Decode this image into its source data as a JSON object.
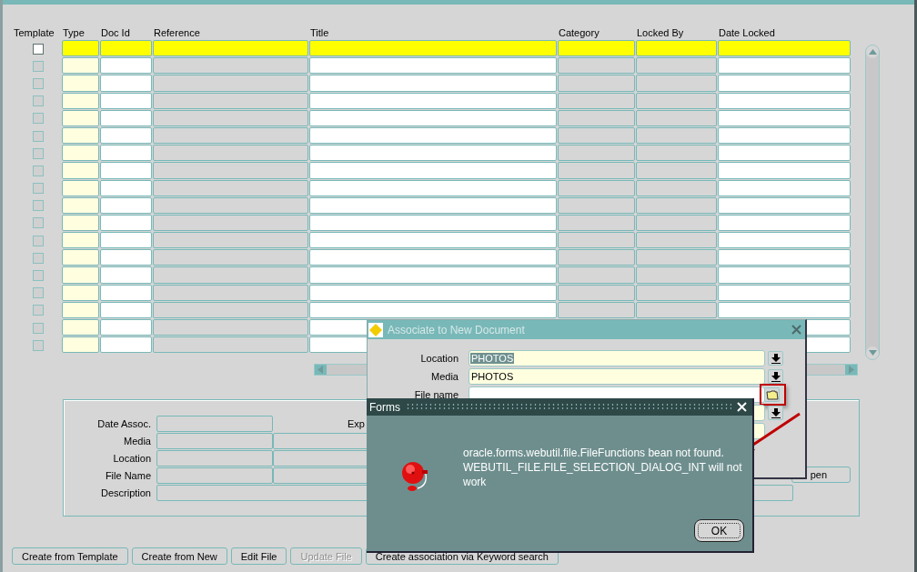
{
  "grid": {
    "columns": [
      "Template",
      "Type",
      "Doc Id",
      "Reference",
      "Title",
      "Category",
      "Locked By",
      "Date Locked"
    ],
    "records": [
      {
        "current": true,
        "checked": false
      },
      {
        "current": false,
        "checked": false
      },
      {
        "current": false,
        "checked": false
      },
      {
        "current": false,
        "checked": false
      },
      {
        "current": false,
        "checked": false
      },
      {
        "current": false,
        "checked": false
      },
      {
        "current": false,
        "checked": false
      },
      {
        "current": false,
        "checked": false
      },
      {
        "current": false,
        "checked": false
      },
      {
        "current": false,
        "checked": false
      },
      {
        "current": false,
        "checked": false
      },
      {
        "current": false,
        "checked": false
      },
      {
        "current": false,
        "checked": false
      },
      {
        "current": false,
        "checked": false
      },
      {
        "current": false,
        "checked": false
      },
      {
        "current": false,
        "checked": false
      },
      {
        "current": false,
        "checked": false
      },
      {
        "current": false,
        "checked": false
      }
    ]
  },
  "details": {
    "labels": [
      "Date Assoc.",
      "Media",
      "Location",
      "File Name",
      "Description"
    ],
    "exp_label": "Exp",
    "open_button": "pen"
  },
  "buttons": [
    {
      "label": "Create from Template",
      "disabled": false
    },
    {
      "label": "Create from New",
      "disabled": false
    },
    {
      "label": "Edit File",
      "disabled": false
    },
    {
      "label": "Update File",
      "disabled": true
    },
    {
      "label": "Create association via Keyword search",
      "disabled": false
    }
  ],
  "associate_dialog": {
    "title": "Associate to New Document",
    "fields": [
      {
        "label": "Location",
        "value": "PHOTOS",
        "highlighted": true,
        "kind": "lov"
      },
      {
        "label": "Media",
        "value": "PHOTOS",
        "highlighted": false,
        "kind": "lov"
      },
      {
        "label": "File name",
        "kind": "file"
      },
      {
        "kind": "lov"
      },
      {
        "kind": "plain"
      }
    ]
  },
  "alert": {
    "title": "Forms",
    "message": "oracle.forms.webutil.file.FileFunctions bean not found. WEBUTIL_FILE.FILE_SELECTION_DIALOG_INT will not work",
    "button": "OK"
  }
}
